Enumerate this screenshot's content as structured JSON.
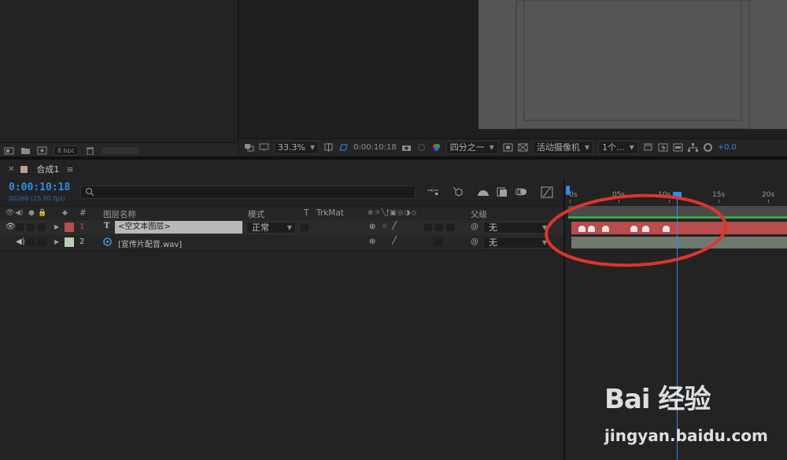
{
  "project": {
    "bpc": "8 bpc"
  },
  "viewer": {
    "zoom": "33.3%",
    "timecode": "0:00:10:18",
    "resolution": "四分之一",
    "camera": "活动摄像机",
    "views": "1个...",
    "exposure": "+0.0"
  },
  "comp_tab": {
    "label": "合成1"
  },
  "timeline": {
    "timecode": "0:00:10:18",
    "frame_info": "00268 (25.00 fps)",
    "search_placeholder": "",
    "columns": {
      "hash": "#",
      "layer_name": "图层名称",
      "mode": "模式",
      "t": "T",
      "trkmat": "TrkMat",
      "parent": "父级"
    },
    "layers": [
      {
        "index": "1",
        "type_glyph": "T",
        "name": "<空文本图层>",
        "mode": "正常",
        "parent": "无",
        "label_color": "#b94c4c"
      },
      {
        "index": "2",
        "name": "[宣传片配音.wav]",
        "parent": "无",
        "label_color": "#b7cdb3"
      }
    ],
    "ruler": [
      "0s",
      "05s",
      "10s",
      "15s",
      "20s"
    ],
    "colors": {
      "cti": "#2d8ceb",
      "text_bar": "#b94c4c",
      "audio_bar": "#6e7a70",
      "annotation": "#e0342c"
    }
  },
  "watermark": {
    "logo": "Bai 经验",
    "url": "jingyan.baidu.com"
  }
}
